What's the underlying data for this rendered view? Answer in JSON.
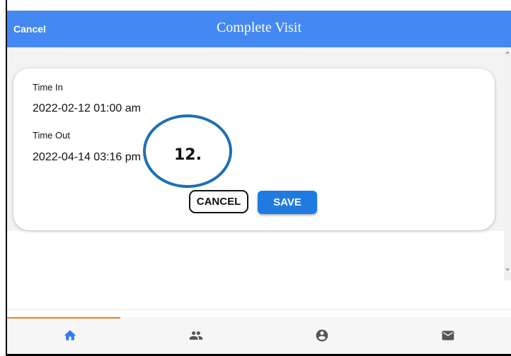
{
  "header": {
    "cancel_label": "Cancel",
    "title": "Complete Visit",
    "background_color": "#4488f2"
  },
  "visit": {
    "time_in_label": "Time In",
    "time_in_value": "2022-02-12 01:00 am",
    "time_out_label": "Time Out",
    "time_out_value": "2022-04-14 03:16 pm"
  },
  "actions": {
    "cancel_label": "CANCEL",
    "save_label": "SAVE",
    "save_color": "#1f7be0"
  },
  "annotation": {
    "text": "12."
  },
  "bottom_nav": {
    "active_index": 0,
    "active_color": "#f07d1e",
    "items": [
      {
        "icon": "home-icon",
        "active": true
      },
      {
        "icon": "people-icon",
        "active": false
      },
      {
        "icon": "account-circle-icon",
        "active": false
      },
      {
        "icon": "mail-icon",
        "active": false
      }
    ]
  }
}
